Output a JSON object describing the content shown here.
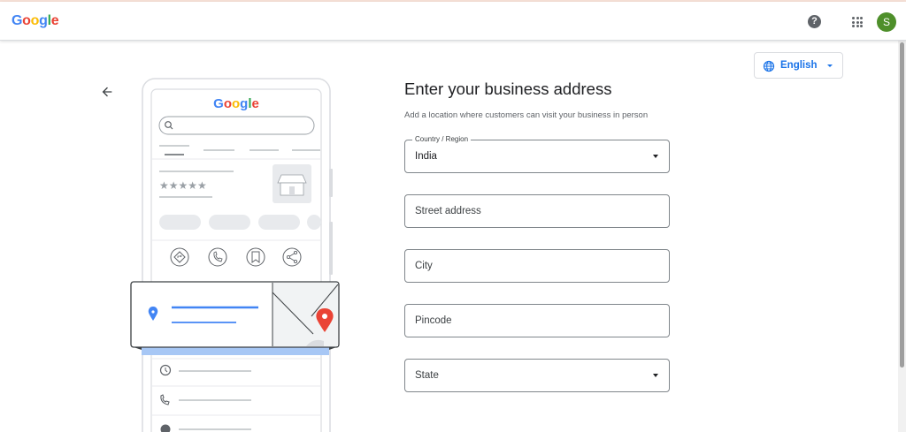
{
  "header": {
    "logo_text": "Google",
    "logo_colors": [
      "#4285F4",
      "#EA4335",
      "#FBBC05",
      "#4285F4",
      "#34A853",
      "#EA4335"
    ],
    "help_glyph": "?",
    "avatar_letter": "S"
  },
  "language": {
    "label": "English",
    "icon": "globe-icon"
  },
  "form": {
    "title": "Enter your business address",
    "subtitle": "Add a location where customers can visit your business in person",
    "country": {
      "label": "Country / Region",
      "value": "India"
    },
    "street": {
      "placeholder": "Street address"
    },
    "city": {
      "placeholder": "City"
    },
    "pincode": {
      "placeholder": "Pincode"
    },
    "state": {
      "placeholder": "State"
    }
  },
  "illustration": {
    "logo_text": "Google",
    "icons": [
      "directions-icon",
      "phone-icon",
      "bookmark-icon",
      "share-icon",
      "location-pin-icon",
      "map-pin-icon",
      "clock-icon",
      "phone-icon",
      "globe-icon"
    ]
  },
  "colors": {
    "accent": "#1a73e8",
    "avatar_bg": "#4e8f2a",
    "pin_red": "#ea4335"
  }
}
